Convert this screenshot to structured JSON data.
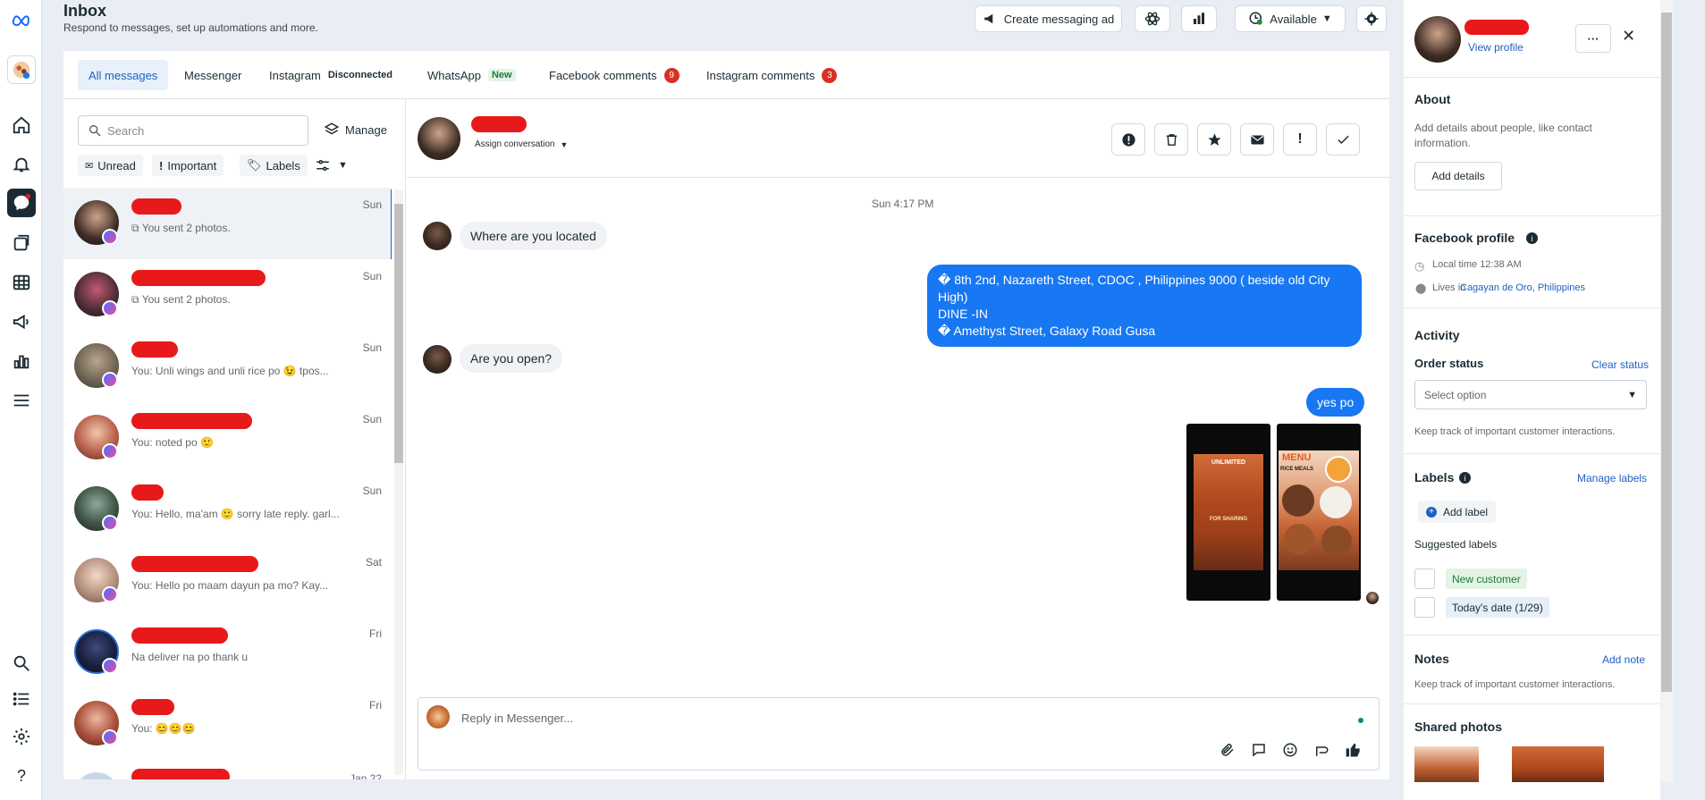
{
  "header": {
    "title": "Inbox",
    "subtitle": "Respond to messages, set up automations and more.",
    "create_ad_label": "Create messaging ad",
    "availability_label": "Available"
  },
  "tabs": [
    {
      "label": "All messages"
    },
    {
      "label": "Messenger"
    },
    {
      "label": "Instagram",
      "badge": "Disconnected"
    },
    {
      "label": "WhatsApp",
      "badge": "New"
    },
    {
      "label": "Facebook comments",
      "count": "9"
    },
    {
      "label": "Instagram comments",
      "count": "3"
    }
  ],
  "list": {
    "search_placeholder": "Search",
    "manage_label": "Manage",
    "filters": {
      "unread": "Unread",
      "important": "Important",
      "labels": "Labels"
    },
    "conversations": [
      {
        "preview": "You sent 2 photos.",
        "time": "Sun"
      },
      {
        "preview": "You sent 2 photos.",
        "time": "Sun"
      },
      {
        "preview": "You: Unli wings and unli rice po 😉 tpos...",
        "time": "Sun"
      },
      {
        "preview": "You: noted po 🙂",
        "time": "Sun"
      },
      {
        "preview": "You: Hello, ma'am 🙂 sorry late reply. garl...",
        "time": "Sun"
      },
      {
        "preview": "You: Hello po maam dayun pa mo? Kay...",
        "time": "Sat"
      },
      {
        "preview": "Na deliver na po thank u",
        "time": "Fri"
      },
      {
        "preview": "You: 😊😊😊",
        "time": "Fri"
      },
      {
        "preview": "",
        "time": "Jan 22"
      }
    ]
  },
  "chat": {
    "assign_label": "Assign conversation",
    "timestamp": "Sun 4:17 PM",
    "messages": [
      {
        "dir": "in",
        "text": "Where are you located"
      },
      {
        "dir": "out",
        "lines": [
          "� 8th 2nd, Nazareth Street, CDOC , Philippines 9000 ( beside old City High)",
          "DINE -IN",
          "� Amethyst Street, Galaxy Road Gusa"
        ]
      },
      {
        "dir": "in",
        "text": "Are you open?"
      },
      {
        "dir": "out",
        "text": "yes po"
      }
    ],
    "images": [
      {
        "title": "UNLIMITED",
        "caption": "FOR SHARING"
      },
      {
        "title": "MENU",
        "caption": "RICE MEALS"
      }
    ],
    "reply_placeholder": "Reply in Messenger..."
  },
  "profile": {
    "view_profile": "View profile",
    "about_title": "About",
    "about_text": "Add details about people, like contact information.",
    "add_details": "Add details",
    "fb_profile_title": "Facebook profile",
    "local_time": "Local time 12:38 AM",
    "lives_in_prefix": "Lives in",
    "lives_in_place": "Cagayan de Oro, Philippines",
    "activity_title": "Activity",
    "order_status_label": "Order status",
    "clear_status": "Clear status",
    "select_option": "Select option",
    "activity_hint": "Keep track of important customer interactions.",
    "labels_title": "Labels",
    "manage_labels": "Manage labels",
    "add_label": "Add label",
    "suggested_labels": "Suggested labels",
    "label_new_customer": "New customer",
    "label_todays_date": "Today's date (1/29)",
    "notes_title": "Notes",
    "add_note": "Add note",
    "notes_hint": "Keep track of important customer interactions.",
    "shared_photos_title": "Shared photos"
  },
  "colors": {
    "accent": "#1877f2",
    "brand_link": "#1d61c4",
    "redact": "#e8191a",
    "badge": "#d93025"
  }
}
